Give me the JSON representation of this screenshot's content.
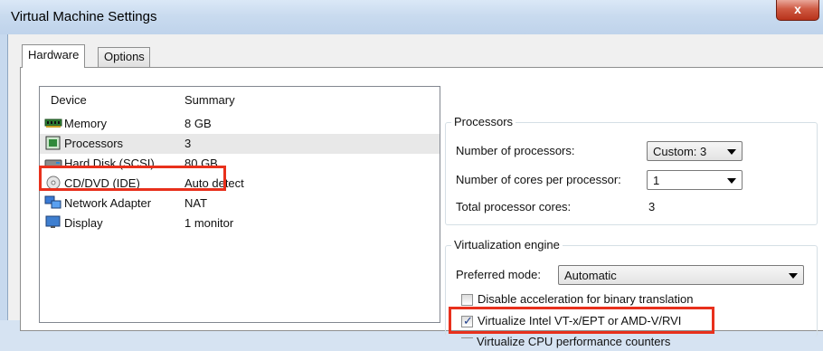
{
  "window": {
    "title": "Virtual Machine Settings",
    "close_icon": "close-icon",
    "close_glyph": "x"
  },
  "tabs": [
    {
      "label": "Hardware"
    },
    {
      "label": "Options"
    }
  ],
  "device_list": {
    "headers": {
      "device": "Device",
      "summary": "Summary"
    },
    "rows": [
      {
        "device": "Memory",
        "summary": "8 GB",
        "icon": "memory-icon"
      },
      {
        "device": "Processors",
        "summary": "3",
        "icon": "processor-icon",
        "selected": true
      },
      {
        "device": "Hard Disk (SCSI)",
        "summary": "80 GB",
        "icon": "hard-disk-icon"
      },
      {
        "device": "CD/DVD (IDE)",
        "summary": "Auto detect",
        "icon": "cd-dvd-icon"
      },
      {
        "device": "Network Adapter",
        "summary": "NAT",
        "icon": "network-adapter-icon"
      },
      {
        "device": "Display",
        "summary": "1 monitor",
        "icon": "display-icon"
      }
    ]
  },
  "processors": {
    "legend": "Processors",
    "num_processors_label": "Number of processors:",
    "num_processors_value": "Custom: 3",
    "cores_label": "Number of cores per processor:",
    "cores_value": "1",
    "total_label": "Total processor cores:",
    "total_value": "3"
  },
  "virtualization": {
    "legend": "Virtualization engine",
    "preferred_label": "Preferred mode:",
    "preferred_value": "Automatic",
    "options": [
      {
        "label": "Disable acceleration for binary translation",
        "checked": false
      },
      {
        "label": "Virtualize Intel VT-x/EPT or AMD-V/RVI",
        "checked": true
      },
      {
        "label": "Virtualize CPU performance counters",
        "checked": false
      }
    ]
  },
  "colors": {
    "highlight": "#e8301c",
    "selection": "#e8e8e8"
  }
}
